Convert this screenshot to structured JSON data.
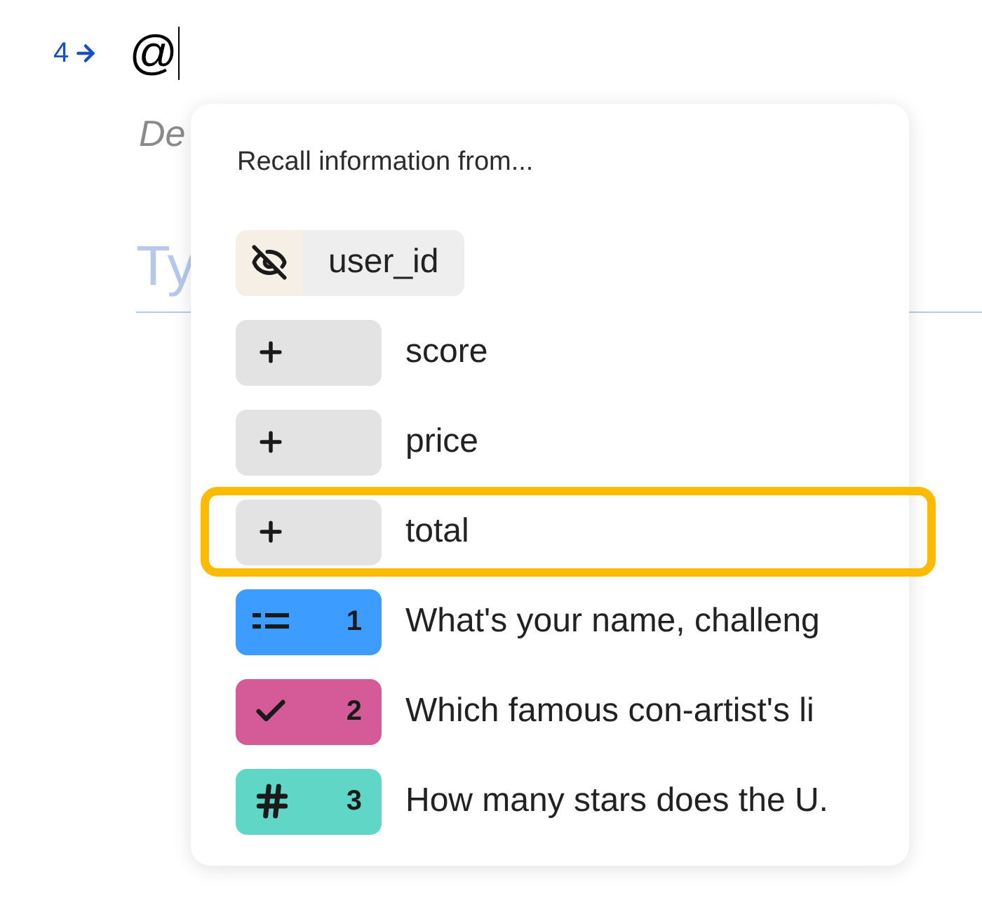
{
  "question": {
    "number": "4",
    "typed": "@",
    "description": "De",
    "answer_placeholder": "Ty"
  },
  "recall_menu": {
    "title": "Recall information from...",
    "items": [
      {
        "kind": "hidden",
        "label": "user_id",
        "selected": false
      },
      {
        "kind": "variable",
        "label": "score",
        "selected": false
      },
      {
        "kind": "variable",
        "label": "price",
        "selected": false
      },
      {
        "kind": "variable",
        "label": "total",
        "selected": true
      },
      {
        "kind": "text",
        "number": "1",
        "color": "#3d9cff",
        "label": "What's your name, challeng",
        "selected": false
      },
      {
        "kind": "choice",
        "number": "2",
        "color": "#d45b98",
        "label": "Which famous con-artist's li",
        "selected": false
      },
      {
        "kind": "number",
        "number": "3",
        "color": "#5fd6c6",
        "label": "How many stars does the U.",
        "selected": false
      }
    ]
  }
}
